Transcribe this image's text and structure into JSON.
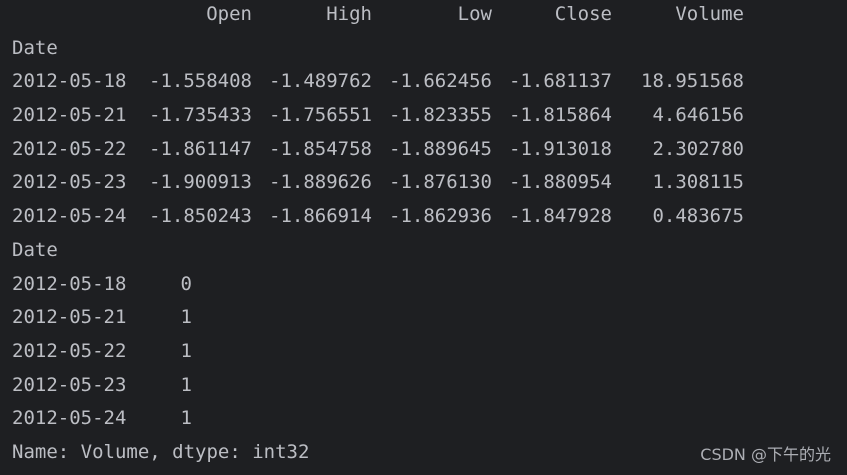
{
  "dataframe": {
    "columns": [
      "Open",
      "High",
      "Low",
      "Close",
      "Volume"
    ],
    "index_name": "Date",
    "rows": [
      {
        "date": "2012-05-18",
        "open": "-1.558408",
        "high": "-1.489762",
        "low": "-1.662456",
        "close": "-1.681137",
        "volume": "18.951568"
      },
      {
        "date": "2012-05-21",
        "open": "-1.735433",
        "high": "-1.756551",
        "low": "-1.823355",
        "close": "-1.815864",
        "volume": "4.646156"
      },
      {
        "date": "2012-05-22",
        "open": "-1.861147",
        "high": "-1.854758",
        "low": "-1.889645",
        "close": "-1.913018",
        "volume": "2.302780"
      },
      {
        "date": "2012-05-23",
        "open": "-1.900913",
        "high": "-1.889626",
        "low": "-1.876130",
        "close": "-1.880954",
        "volume": "1.308115"
      },
      {
        "date": "2012-05-24",
        "open": "-1.850243",
        "high": "-1.866914",
        "low": "-1.862936",
        "close": "-1.847928",
        "volume": "0.483675"
      }
    ]
  },
  "series": {
    "index_name": "Date",
    "rows": [
      {
        "date": "2012-05-18",
        "value": "0"
      },
      {
        "date": "2012-05-21",
        "value": "1"
      },
      {
        "date": "2012-05-22",
        "value": "1"
      },
      {
        "date": "2012-05-23",
        "value": "1"
      },
      {
        "date": "2012-05-24",
        "value": "1"
      }
    ],
    "footer": "Name: Volume, dtype: int32"
  },
  "watermark": "CSDN @下午的光",
  "colors": {
    "background": "#1e1f22",
    "text": "#bcbec4"
  }
}
